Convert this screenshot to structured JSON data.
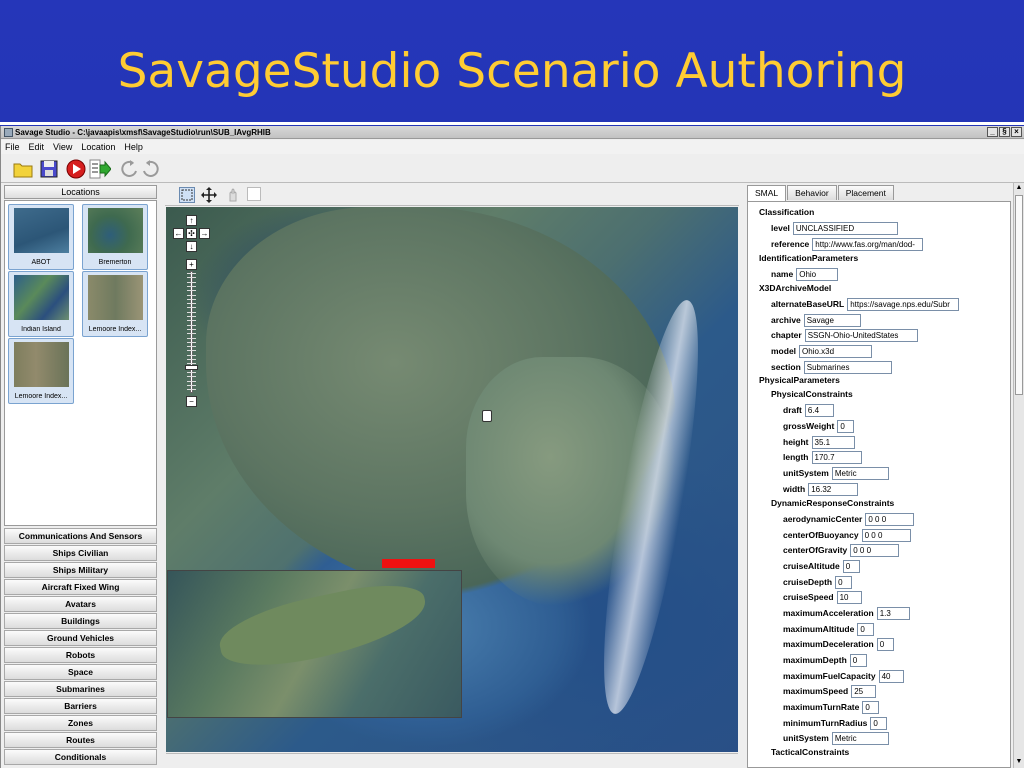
{
  "slide": {
    "title": "SavageStudio Scenario Authoring"
  },
  "window": {
    "title": "Savage Studio - C:\\javaapis\\xmsf\\SavageStudio\\run\\SUB_IAvgRHIB",
    "minimize": "_",
    "maximize": "§",
    "close": "×"
  },
  "menu": [
    "File",
    "Edit",
    "View",
    "Location",
    "Help"
  ],
  "left": {
    "locations_header": "Locations",
    "locations": [
      {
        "label": "ABOT"
      },
      {
        "label": "Bremerton"
      },
      {
        "label": "Indian Island"
      },
      {
        "label": "Lemoore Index..."
      },
      {
        "label": "Lemoore Index..."
      }
    ],
    "categories": [
      "Communications And Sensors",
      "Ships Civilian",
      "Ships Military",
      "Aircraft Fixed Wing",
      "Avatars",
      "Buildings",
      "Ground Vehicles",
      "Robots",
      "Space",
      "Submarines",
      "Barriers",
      "Zones",
      "Routes",
      "Conditionals"
    ]
  },
  "map": {
    "nav": {
      "up": "↑",
      "down": "↓",
      "left": "←",
      "right": "→",
      "center": "✣"
    },
    "zoom_in": "+",
    "zoom_out": "−",
    "zoom_level": 0.8
  },
  "right": {
    "tabs": [
      "SMAL",
      "Behavior",
      "Placement"
    ],
    "groups": {
      "classification": "Classification",
      "identification": "IdentificationParameters",
      "archive_model": "X3DArchiveModel",
      "physical": "PhysicalParameters",
      "physical_constraints": "PhysicalConstraints",
      "dynamic": "DynamicResponseConstraints",
      "tactical": "TacticalConstraints"
    },
    "fields": {
      "level": {
        "k": "level",
        "v": "UNCLASSIFIED"
      },
      "reference": {
        "k": "reference",
        "v": "http://www.fas.org/man/dod-"
      },
      "name": {
        "k": "name",
        "v": "Ohio"
      },
      "alternateBaseURL": {
        "k": "alternateBaseURL",
        "v": "https://savage.nps.edu/Subr"
      },
      "archive": {
        "k": "archive",
        "v": "Savage"
      },
      "chapter": {
        "k": "chapter",
        "v": "SSGN-Ohio-UnitedStates"
      },
      "model": {
        "k": "model",
        "v": "Ohio.x3d"
      },
      "section": {
        "k": "section",
        "v": "Submarines"
      },
      "draft": {
        "k": "draft",
        "v": "6.4"
      },
      "grossWeight": {
        "k": "grossWeight",
        "v": "0"
      },
      "height": {
        "k": "height",
        "v": "35.1"
      },
      "length": {
        "k": "length",
        "v": "170.7"
      },
      "unitSystem1": {
        "k": "unitSystem",
        "v": "Metric"
      },
      "width": {
        "k": "width",
        "v": "16.32"
      },
      "aerodynamicCenter": {
        "k": "aerodynamicCenter",
        "v": "0 0 0"
      },
      "centerOfBuoyancy": {
        "k": "centerOfBuoyancy",
        "v": "0 0 0"
      },
      "centerOfGravity": {
        "k": "centerOfGravity",
        "v": "0 0 0"
      },
      "cruiseAltitude": {
        "k": "cruiseAltitude",
        "v": "0"
      },
      "cruiseDepth": {
        "k": "cruiseDepth",
        "v": "0"
      },
      "cruiseSpeed": {
        "k": "cruiseSpeed",
        "v": "10"
      },
      "maximumAcceleration": {
        "k": "maximumAcceleration",
        "v": "1.3"
      },
      "maximumAltitude": {
        "k": "maximumAltitude",
        "v": "0"
      },
      "maximumDeceleration": {
        "k": "maximumDeceleration",
        "v": "0"
      },
      "maximumDepth": {
        "k": "maximumDepth",
        "v": "0"
      },
      "maximumFuelCapacity": {
        "k": "maximumFuelCapacity",
        "v": "40"
      },
      "maximumSpeed": {
        "k": "maximumSpeed",
        "v": "25"
      },
      "maximumTurnRate": {
        "k": "maximumTurnRate",
        "v": "0"
      },
      "minimumTurnRadius": {
        "k": "minimumTurnRadius",
        "v": "0"
      },
      "unitSystem2": {
        "k": "unitSystem",
        "v": "Metric"
      }
    }
  },
  "colors": {
    "slide_bg": "#2233aa",
    "title": "#ffcc33",
    "selection": "#d7e4f4",
    "red_marker": "#ee1111"
  }
}
